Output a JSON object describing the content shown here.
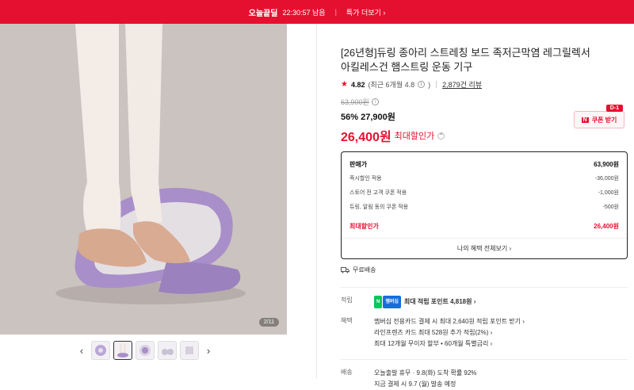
{
  "topbar": {
    "deal_label": "오늘끝딜",
    "timer": "22:30:57 남음",
    "more_deals": "특가 더보기 ›"
  },
  "gallery": {
    "pager": "2/11",
    "prev_icon": "‹",
    "next_icon": "›"
  },
  "product": {
    "title_line1": "[26년형]듀링 종아리 스트레칭 보드 족저근막염 레그릴렉서",
    "title_line2": "아킬레스건 햄스트링 운동 기구",
    "rating": "4.82",
    "rating_recent": "(최근 6개월 4.8",
    "reviews": "2,879건 리뷰",
    "original_price": "63,900원",
    "discount_pct": "56%",
    "discount_price": "27,900원",
    "final_price": "26,400원",
    "final_label": "최대할인가"
  },
  "coupon": {
    "dday": "D-1",
    "label": "쿠폰 받기",
    "n_badge": "N"
  },
  "breakdown": {
    "rows": [
      {
        "label": "판매가",
        "value": "63,900원"
      },
      {
        "label": "즉시할인 적용",
        "value": "-36,000원"
      },
      {
        "label": "스토어 전 고객 쿠폰 적용",
        "value": "-1,000원"
      },
      {
        "label": "듀링, 알림 동의 쿠폰 적용",
        "value": "-500원"
      }
    ],
    "total_label": "최대할인가",
    "total_value": "26,400원",
    "more": "나의 혜택 전체보기 ›"
  },
  "shipping_free": "무료배송",
  "sections": {
    "points_key": "적립",
    "points_text": "최대 적립 포인트 4,818원 ›",
    "npay_badge": "N",
    "npay_badge2": "멤버십",
    "benefit_key": "혜택",
    "benefit_lines": [
      "멤버십 전용카드 결제 시 최대 2,640원 적립 포인트 받기 ›",
      "라인프렌즈 카드 최대 528원 추가 적립(2%) ›",
      "최대 12개월 무이자 할부 • 60개월 특별금리 ›"
    ],
    "delivery_key": "배송",
    "delivery_lines": [
      "오늘출발 휴무 · 9.8(화) 도착 확률 92%",
      "지금 결제 시 9.7 (월) 발송 예정"
    ]
  }
}
